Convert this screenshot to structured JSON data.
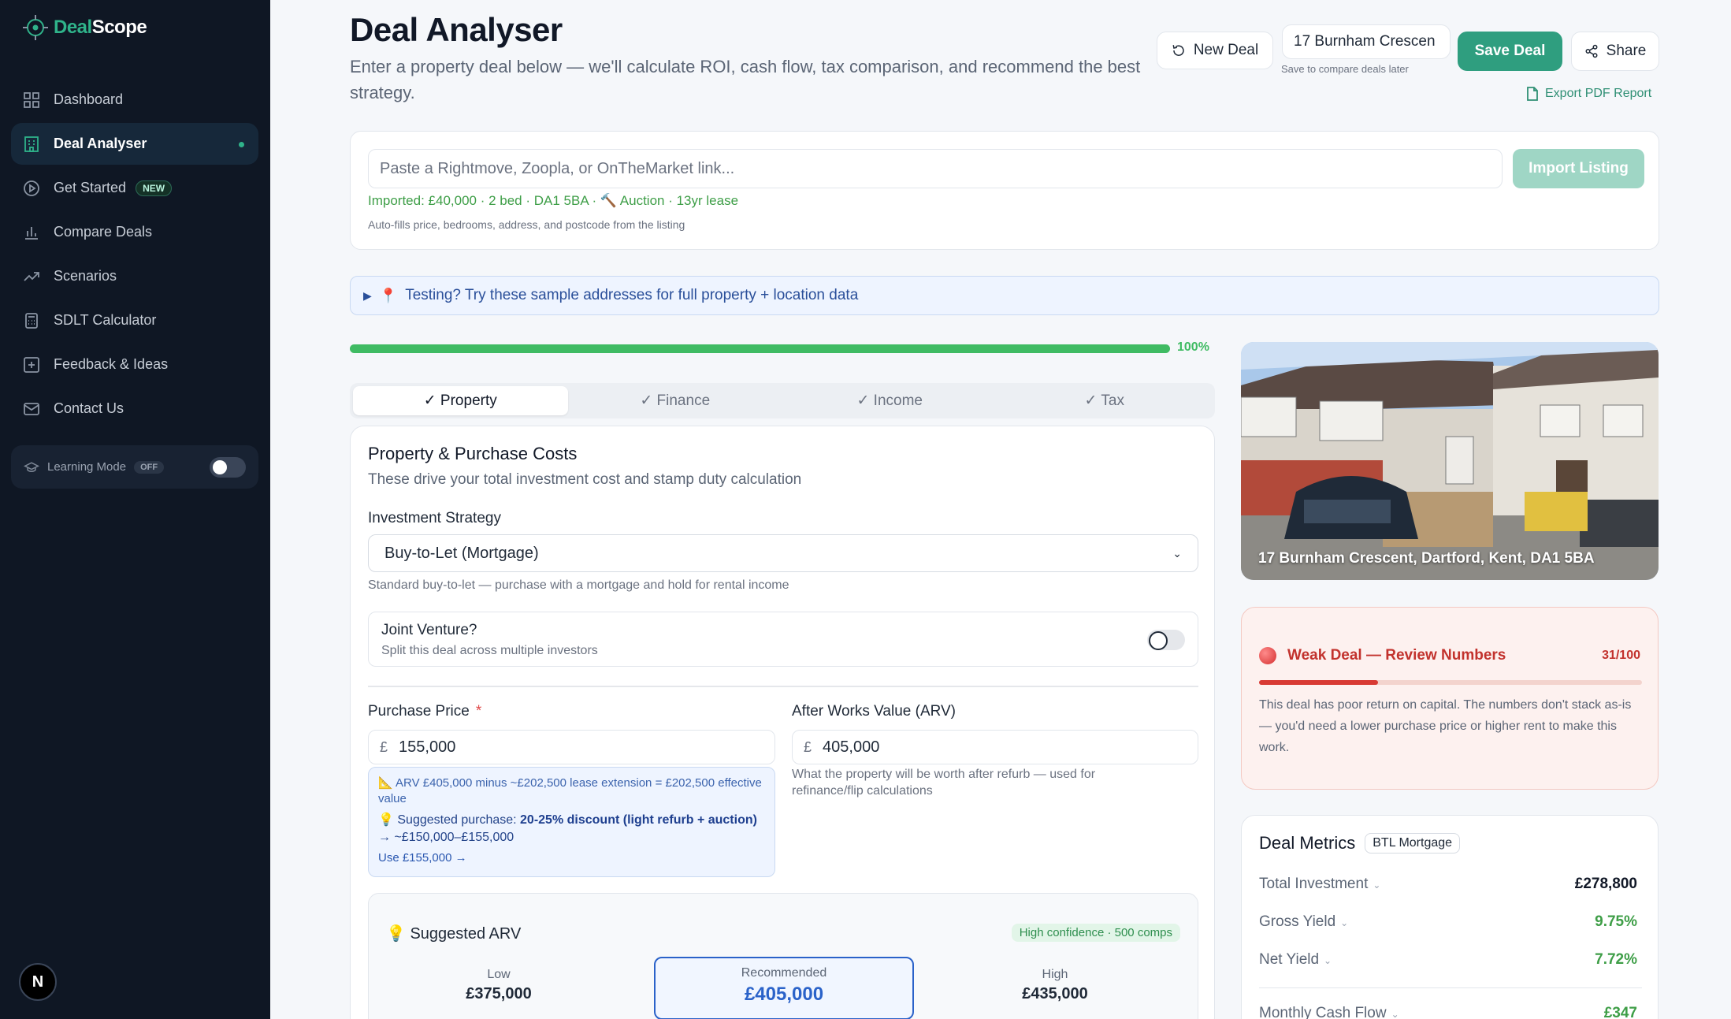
{
  "brand": {
    "part1": "Deal",
    "part2": "Scope"
  },
  "sidebar": {
    "items": [
      {
        "label": "Dashboard",
        "icon": "dashboard-icon"
      },
      {
        "label": "Deal Analyser",
        "icon": "building-icon",
        "active": true
      },
      {
        "label": "Get Started",
        "icon": "play-icon",
        "badge": "NEW"
      },
      {
        "label": "Compare Deals",
        "icon": "bar-chart-icon"
      },
      {
        "label": "Scenarios",
        "icon": "trend-icon"
      },
      {
        "label": "SDLT Calculator",
        "icon": "calculator-icon"
      },
      {
        "label": "Feedback & Ideas",
        "icon": "feedback-icon"
      },
      {
        "label": "Contact Us",
        "icon": "mail-icon"
      }
    ],
    "learning": {
      "label": "Learning Mode",
      "state": "OFF"
    },
    "avatar": "N"
  },
  "header": {
    "title": "Deal Analyser",
    "subtitle": "Enter a property deal below — we'll calculate ROI, cash flow, tax comparison, and recommend the best strategy.",
    "new_deal": "New Deal",
    "deal_name": "17 Burnham Crescen",
    "save_hint": "Save to compare deals later",
    "save_deal": "Save Deal",
    "share": "Share",
    "export": "Export PDF Report"
  },
  "import": {
    "placeholder": "Paste a Rightmove, Zoopla, or OnTheMarket link...",
    "button": "Import Listing",
    "imported": "Imported: £40,000 · 2 bed · DA1 5BA · 🔨 Auction · 13yr lease",
    "hint": "Auto-fills price, bedrooms, address, and postcode from the listing"
  },
  "samples": {
    "label": "Testing? Try these sample addresses for full property + location data"
  },
  "progress": {
    "value": 100,
    "label": "100%"
  },
  "tabs": [
    "✓ Property",
    "✓ Finance",
    "✓ Income",
    "✓ Tax"
  ],
  "form": {
    "title": "Property & Purchase Costs",
    "subtitle": "These drive your total investment cost and stamp duty calculation",
    "strategy_label": "Investment Strategy",
    "strategy_value": "Buy-to-Let (Mortgage)",
    "strategy_hint": "Standard buy-to-let — purchase with a mortgage and hold for rental income",
    "jv_title": "Joint Venture?",
    "jv_sub": "Split this deal across multiple investors",
    "purchase_label": "Purchase Price",
    "purchase_req": "*",
    "currency": "£",
    "purchase_value": "155,000",
    "arv_label": "After Works Value (ARV)",
    "arv_value": "405,000",
    "arv_hint": "What the property will be worth after refurb — used for refinance/flip calculations",
    "info_l1": "📐 ARV £405,000 minus ~£202,500 lease extension = £202,500 effective value",
    "info_l2_prefix": "💡 Suggested purchase: ",
    "info_l2_bold": "20-25% discount (light refurb + auction)",
    "info_l2_suffix": " → ~£150,000–£155,000",
    "info_l3": "Use £155,000 →"
  },
  "suggested_arv": {
    "title": "💡 Suggested ARV",
    "confidence": "High confidence · 500 comps",
    "low_label": "Low",
    "low_value": "£375,000",
    "rec_label": "Recommended",
    "rec_value": "£405,000",
    "high_label": "High",
    "high_value": "£435,000"
  },
  "photo": {
    "caption": "17 Burnham Crescent, Dartford, Kent, DA1 5BA"
  },
  "score": {
    "title": "Weak Deal — Review Numbers",
    "value": "31/100",
    "fraction": 0.31,
    "text": "This deal has poor return on capital. The numbers don't stack as-is — you'd need a lower purchase price or higher rent to make this work."
  },
  "metrics": {
    "title": "Deal Metrics",
    "badge": "BTL Mortgage",
    "rows": [
      {
        "label": "Total Investment",
        "value": "£278,800"
      },
      {
        "label": "Gross Yield",
        "value": "9.75%"
      },
      {
        "label": "Net Yield",
        "value": "7.72%"
      },
      {
        "label": "Monthly Cash Flow",
        "value": "£347"
      }
    ]
  }
}
